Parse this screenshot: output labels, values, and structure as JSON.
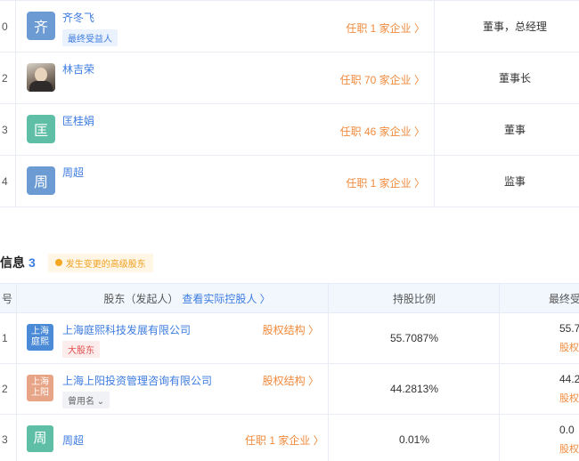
{
  "executives": [
    {
      "num": "0",
      "name": "齐冬飞",
      "avatar_char": "齐",
      "tag": "最终受益人",
      "office": "任职 1 家企业 〉",
      "role": "董事，总经理"
    },
    {
      "num": "2",
      "name": "林吉荣",
      "avatar_char": "",
      "tag": "",
      "office": "任职 70 家企业 〉",
      "role": "董事长"
    },
    {
      "num": "3",
      "name": "匡桂娟",
      "avatar_char": "匡",
      "tag": "",
      "office": "任职 46 家企业 〉",
      "role": "董事"
    },
    {
      "num": "4",
      "name": "周超",
      "avatar_char": "周",
      "tag": "",
      "office": "任职 1 家企业 〉",
      "role": "监事"
    }
  ],
  "shareholders_section": {
    "title": "信息",
    "count": "3",
    "warning": "发生变更的高级股东"
  },
  "holders_header": {
    "num": "号",
    "holder": "股东（发起人）",
    "holder_link": "查看实际控股人 〉",
    "ratio": "持股比例",
    "final": "最终受"
  },
  "holders": [
    {
      "num": "1",
      "logo": "上海\n庭熙",
      "logo_color": "#4a8ad6",
      "name": "上海庭熙科技发展有限公司",
      "tag": "大股东",
      "tag_type": "big",
      "link": "股权结构 〉",
      "ratio": "55.7087%",
      "final": "55.7",
      "final_link": "股权"
    },
    {
      "num": "2",
      "logo": "上海\n上阳",
      "logo_color": "#e8a486",
      "name": "上海上阳投资管理咨询有限公司",
      "tag": "曾用名 ⌄",
      "tag_type": "former",
      "link": "股权结构 〉",
      "ratio": "44.2813%",
      "final": "44.2",
      "final_link": "股权"
    },
    {
      "num": "3",
      "logo": "周",
      "logo_color": "#5fbfa6",
      "name": "周超",
      "tag": "",
      "tag_type": "",
      "link": "任职 1 家企业 〉",
      "ratio": "0.01%",
      "final": "0.0",
      "final_link": "股权"
    }
  ]
}
